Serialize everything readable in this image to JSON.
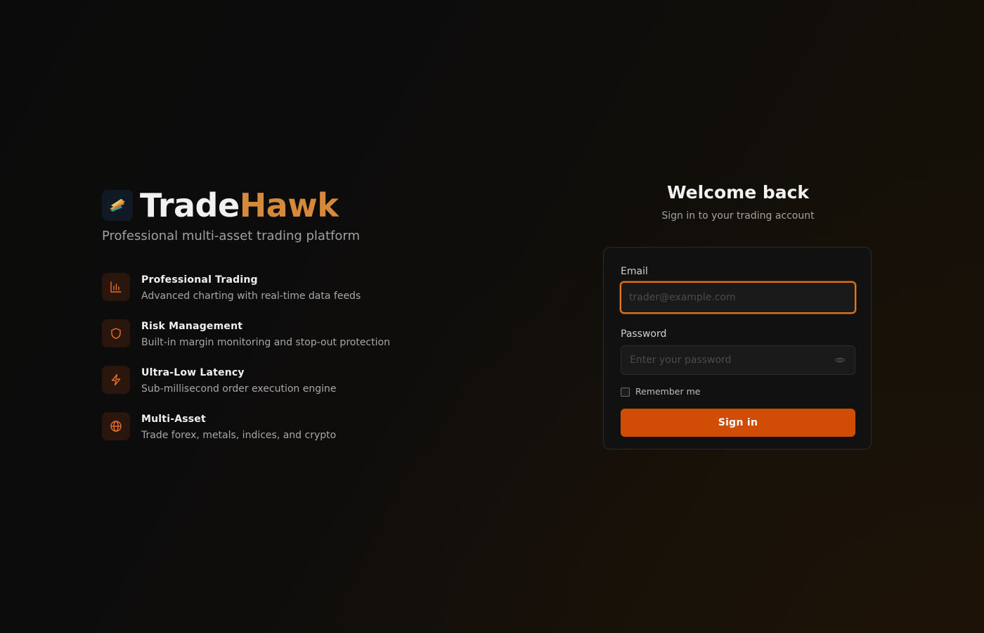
{
  "brand": {
    "name_part_1": "Trade",
    "name_part_2": "Hawk",
    "tagline": "Professional multi-asset trading platform",
    "logo_icon": "hawk-logo-icon"
  },
  "features": [
    {
      "icon": "bar-chart-icon",
      "title": "Professional Trading",
      "description": "Advanced charting with real-time data feeds"
    },
    {
      "icon": "shield-icon",
      "title": "Risk Management",
      "description": "Built-in margin monitoring and stop-out protection"
    },
    {
      "icon": "lightning-icon",
      "title": "Ultra-Low Latency",
      "description": "Sub-millisecond order execution engine"
    },
    {
      "icon": "globe-icon",
      "title": "Multi-Asset",
      "description": "Trade forex, metals, indices, and crypto"
    }
  ],
  "login": {
    "title": "Welcome back",
    "subtitle": "Sign in to your trading account",
    "email_label": "Email",
    "email_placeholder": "trader@example.com",
    "email_value": "",
    "password_label": "Password",
    "password_placeholder": "Enter your password",
    "password_value": "",
    "remember_label": "Remember me",
    "remember_checked": false,
    "submit_label": "Sign in"
  },
  "colors": {
    "accent": "#d14c05",
    "focus_ring": "#e8741c",
    "brand_highlight": "#d5893b",
    "feature_icon": "#e8702a"
  }
}
